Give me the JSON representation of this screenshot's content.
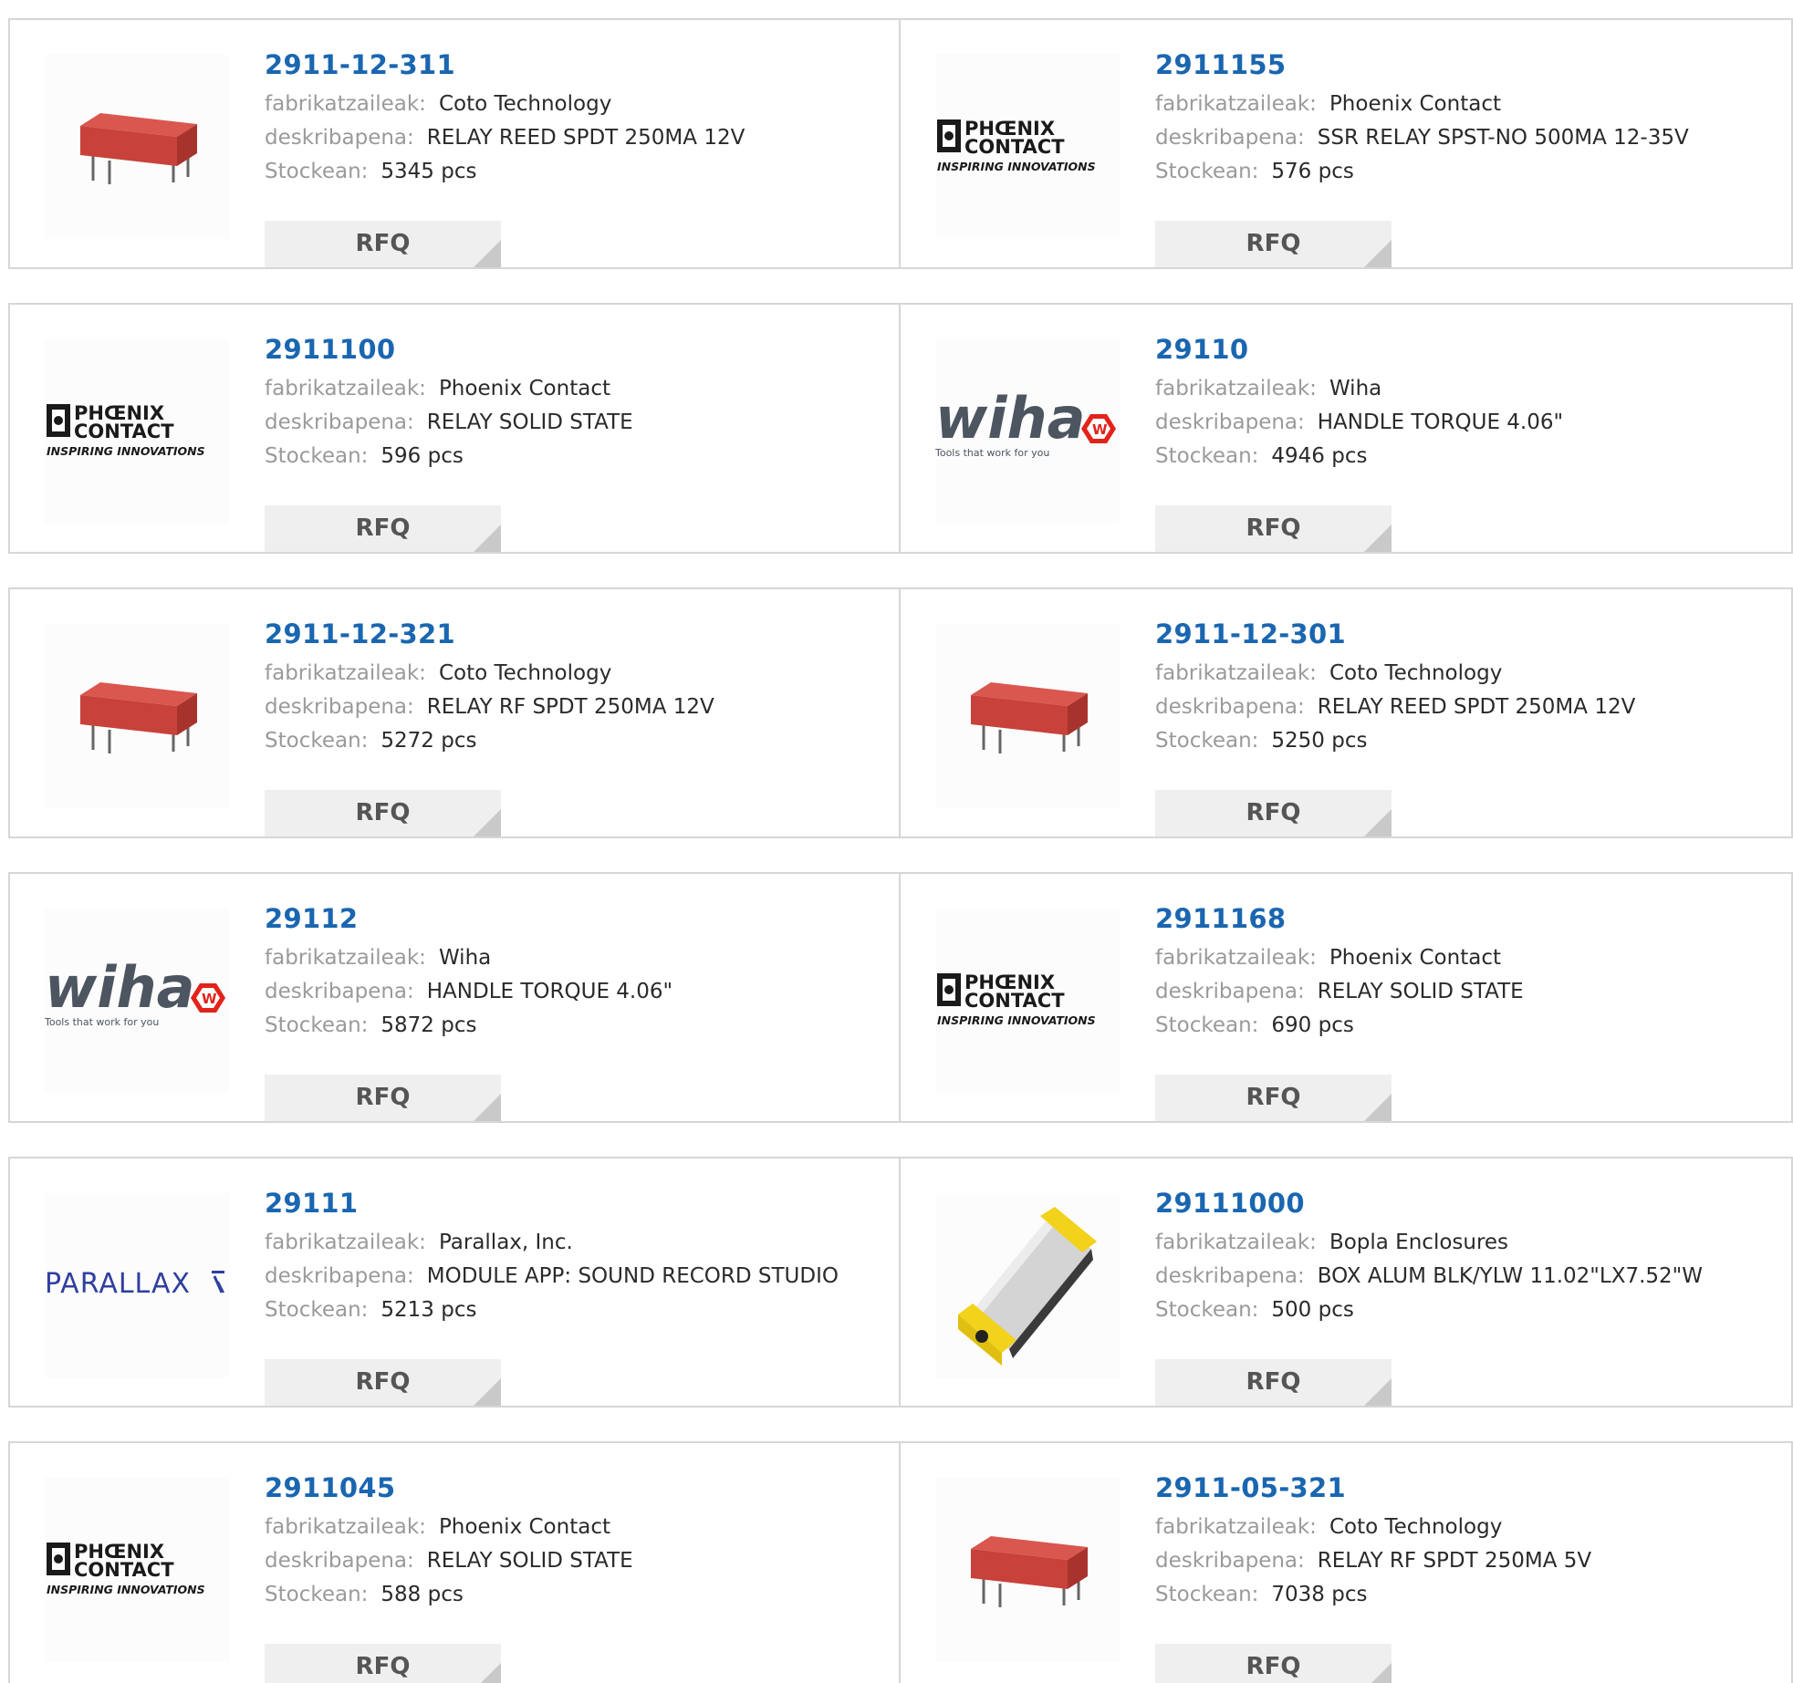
{
  "labels": {
    "manufacturer": "fabrikatzaileak:",
    "description": "deskribapena:",
    "stock": "Stockean:",
    "rfq": "RFQ"
  },
  "products": [
    {
      "part": "2911-12-311",
      "manufacturer": "Coto Technology",
      "description": "RELAY REED SPDT 250MA 12V",
      "stock": "5345 pcs",
      "image": "relay"
    },
    {
      "part": "2911155",
      "manufacturer": "Phoenix Contact",
      "description": "SSR RELAY SPST-NO 500MA 12-35V",
      "stock": "576 pcs",
      "image": "phoenix"
    },
    {
      "part": "2911100",
      "manufacturer": "Phoenix Contact",
      "description": "RELAY SOLID STATE",
      "stock": "596 pcs",
      "image": "phoenix"
    },
    {
      "part": "29110",
      "manufacturer": "Wiha",
      "description": "HANDLE TORQUE 4.06\"",
      "stock": "4946 pcs",
      "image": "wiha"
    },
    {
      "part": "2911-12-321",
      "manufacturer": "Coto Technology",
      "description": "RELAY RF SPDT 250MA 12V",
      "stock": "5272 pcs",
      "image": "relay"
    },
    {
      "part": "2911-12-301",
      "manufacturer": "Coto Technology",
      "description": "RELAY REED SPDT 250MA 12V",
      "stock": "5250 pcs",
      "image": "relay"
    },
    {
      "part": "29112",
      "manufacturer": "Wiha",
      "description": "HANDLE TORQUE 4.06\"",
      "stock": "5872 pcs",
      "image": "wiha"
    },
    {
      "part": "2911168",
      "manufacturer": "Phoenix Contact",
      "description": "RELAY SOLID STATE",
      "stock": "690 pcs",
      "image": "phoenix"
    },
    {
      "part": "29111",
      "manufacturer": "Parallax, Inc.",
      "description": "MODULE APP: SOUND RECORD STUDIO",
      "stock": "5213 pcs",
      "image": "parallax"
    },
    {
      "part": "29111000",
      "manufacturer": "Bopla Enclosures",
      "description": "BOX ALUM BLK/YLW 11.02\"LX7.52\"W",
      "stock": "500 pcs",
      "image": "enclosure"
    },
    {
      "part": "2911045",
      "manufacturer": "Phoenix Contact",
      "description": "RELAY SOLID STATE",
      "stock": "588 pcs",
      "image": "phoenix"
    },
    {
      "part": "2911-05-321",
      "manufacturer": "Coto Technology",
      "description": "RELAY RF SPDT 250MA 5V",
      "stock": "7038 pcs",
      "image": "relay"
    }
  ],
  "logo_text": {
    "phoenix_line1": "PHŒNIX",
    "phoenix_line2": "CONTACT",
    "phoenix_tagline": "INSPIRING INNOVATIONS",
    "wiha_word": "wiha",
    "wiha_tagline": "Tools that work for you",
    "parallax_word": "PARALLAX"
  },
  "colors": {
    "part_link": "#1a66b0",
    "label_gray": "#9a9a9a",
    "value_text": "#2a2a2a",
    "border": "#d6d6d6",
    "rfq_bg": "#efefef",
    "relay_red": "#c8413a",
    "wiha_red": "#e2231a",
    "parallax_blue": "#2f3f9e",
    "bopla_yellow": "#f2d21a"
  }
}
